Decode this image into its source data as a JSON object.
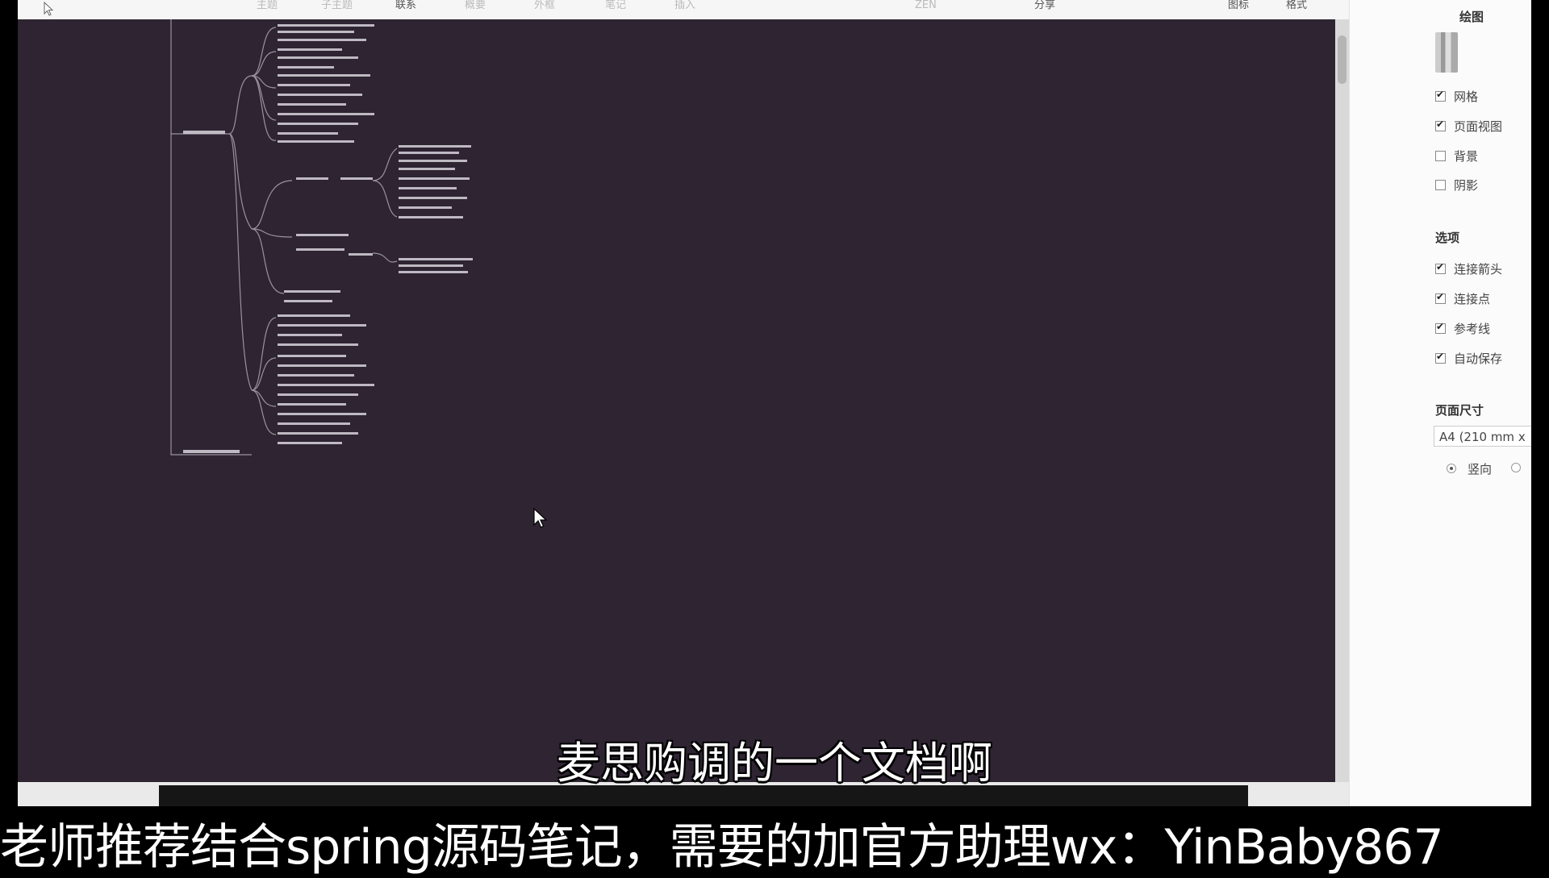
{
  "toolbar": {
    "items": [
      "主题",
      "子主题",
      "联系",
      "概要",
      "外框",
      "笔记",
      "插入",
      "ZEN",
      "分享",
      "图标",
      "格式"
    ]
  },
  "panel": {
    "drawing_title": "绘图",
    "view_options": [
      {
        "label": "网格",
        "checked": true
      },
      {
        "label": "页面视图",
        "checked": true
      },
      {
        "label": "背景",
        "checked": false
      },
      {
        "label": "阴影",
        "checked": false
      }
    ],
    "options_title": "选项",
    "options": [
      {
        "label": "连接箭头",
        "checked": true
      },
      {
        "label": "连接点",
        "checked": true
      },
      {
        "label": "参考线",
        "checked": true
      },
      {
        "label": "自动保存",
        "checked": true
      }
    ],
    "page_size_title": "页面尺寸",
    "page_size_value": "A4 (210 mm x",
    "orientation_label": "竖向"
  },
  "subtitles": {
    "main": "麦思购调的一个文档啊",
    "promo": "老师推荐结合spring源码笔记，需要的加官方助理wx：YinBaby867"
  },
  "colors": {
    "canvas_bg": "#2e2432",
    "panel_bg": "#fbfbfb"
  },
  "icons": {
    "toolbar_pointer": "arrow-pointer-icon",
    "canvas_pointer": "mouse-cursor-icon"
  }
}
